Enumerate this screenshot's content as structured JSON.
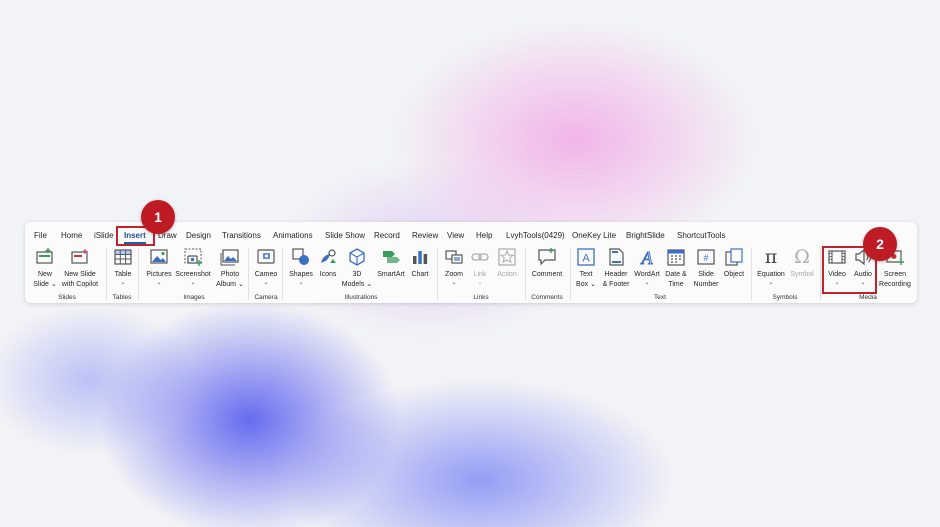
{
  "tabs": [
    "File",
    "Home",
    "iSlide",
    "Insert",
    "Draw",
    "Design",
    "Transitions",
    "Animations",
    "Slide Show",
    "Record",
    "Review",
    "View",
    "Help",
    "LvyhTools(0429)",
    "OneKey Lite",
    "BrightSlide",
    "ShortcutTools"
  ],
  "active_tab": "Insert",
  "groups": [
    "Slides",
    "Tables",
    "Images",
    "Camera",
    "Illustrations",
    "Links",
    "Comments",
    "Text",
    "Symbols",
    "Media"
  ],
  "commands": [
    {
      "line1": "New",
      "line2": "Slide",
      "icon": "new-slide-icon",
      "group": "Slides",
      "dropdown": true
    },
    {
      "line1": "New Slide",
      "line2": "with Copilot",
      "icon": "new-slide-copilot-icon",
      "group": "Slides"
    },
    {
      "line1": "Table",
      "icon": "table-icon",
      "group": "Tables",
      "dropdown": true
    },
    {
      "line1": "Pictures",
      "icon": "pictures-icon",
      "group": "Images",
      "dropdown": true
    },
    {
      "line1": "Screenshot",
      "icon": "screenshot-icon",
      "group": "Images",
      "dropdown": true
    },
    {
      "line1": "Photo",
      "line2": "Album",
      "icon": "photo-album-icon",
      "group": "Images",
      "dropdown": true
    },
    {
      "line1": "Cameo",
      "icon": "cameo-icon",
      "group": "Camera",
      "dropdown": true
    },
    {
      "line1": "Shapes",
      "icon": "shapes-icon",
      "group": "Illustrations",
      "dropdown": true
    },
    {
      "line1": "Icons",
      "icon": "icons-icon",
      "group": "Illustrations"
    },
    {
      "line1": "3D",
      "line2": "Models",
      "icon": "3d-models-icon",
      "group": "Illustrations",
      "dropdown": true
    },
    {
      "line1": "SmartArt",
      "icon": "smartart-icon",
      "group": "Illustrations"
    },
    {
      "line1": "Chart",
      "icon": "chart-icon",
      "group": "Illustrations"
    },
    {
      "line1": "Zoom",
      "icon": "zoom-icon",
      "group": "Links",
      "dropdown": true
    },
    {
      "line1": "Link",
      "icon": "link-icon",
      "group": "Links",
      "dropdown": true,
      "disabled": true
    },
    {
      "line1": "Action",
      "icon": "action-icon",
      "group": "Links",
      "disabled": true
    },
    {
      "line1": "Comment",
      "icon": "comment-icon",
      "group": "Comments"
    },
    {
      "line1": "Text",
      "line2": "Box",
      "icon": "text-box-icon",
      "group": "Text",
      "dropdown": true
    },
    {
      "line1": "Header",
      "line2": "& Footer",
      "icon": "header-footer-icon",
      "group": "Text"
    },
    {
      "line1": "WordArt",
      "icon": "wordart-icon",
      "group": "Text",
      "dropdown": true
    },
    {
      "line1": "Date &",
      "line2": "Time",
      "icon": "date-time-icon",
      "group": "Text"
    },
    {
      "line1": "Slide",
      "line2": "Number",
      "icon": "slide-number-icon",
      "group": "Text"
    },
    {
      "line1": "Object",
      "icon": "object-icon",
      "group": "Text"
    },
    {
      "line1": "Equation",
      "icon": "equation-icon",
      "group": "Symbols",
      "dropdown": true
    },
    {
      "line1": "Symbol",
      "icon": "symbol-icon",
      "group": "Symbols",
      "disabled": true
    },
    {
      "line1": "Video",
      "icon": "video-icon",
      "group": "Media",
      "dropdown": true
    },
    {
      "line1": "Audio",
      "icon": "audio-icon",
      "group": "Media",
      "dropdown": true
    },
    {
      "line1": "Screen",
      "line2": "Recording",
      "icon": "screen-recording-icon",
      "group": "Media"
    }
  ],
  "glyphs": {
    "equation": "π",
    "symbol": "Ω",
    "dropdown": "⌄"
  },
  "annotations": [
    {
      "number": "1",
      "target": "Insert tab"
    },
    {
      "number": "2",
      "target": "Video and Audio"
    }
  ],
  "colors": {
    "accent": "#1f5fb0",
    "annotation": "#be1b25",
    "icon_blue": "#3b6fc4",
    "icon_green": "#3a9b5c"
  }
}
